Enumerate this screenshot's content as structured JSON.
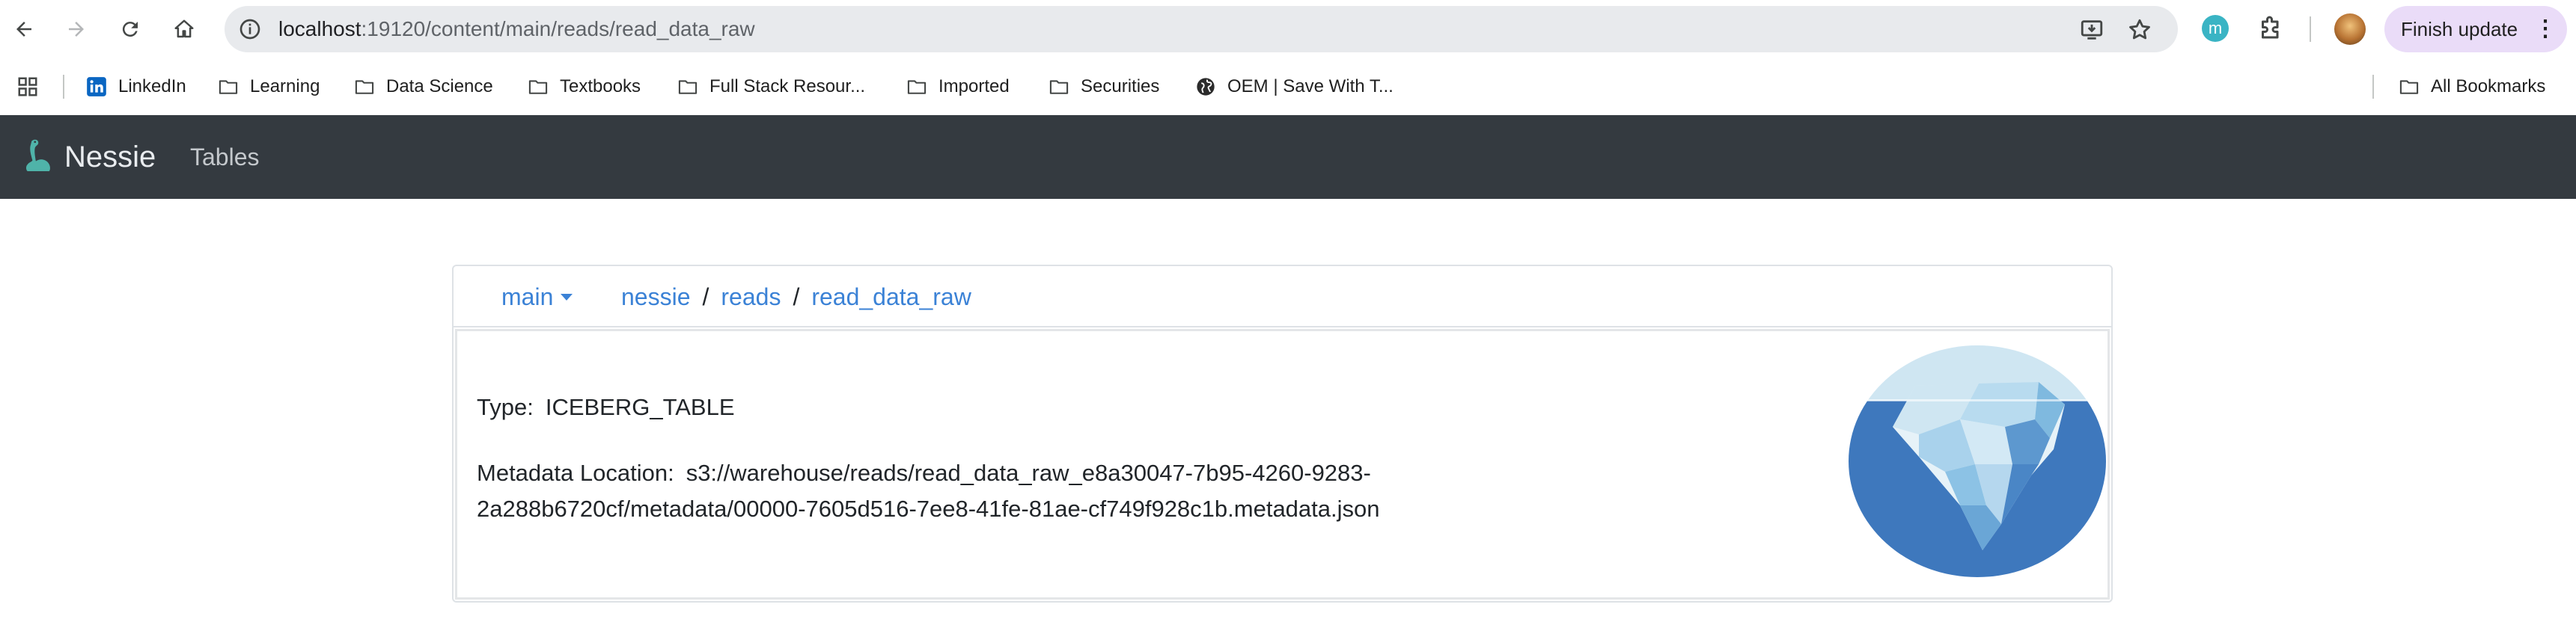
{
  "browser": {
    "url_host": "localhost",
    "url_path": ":19120/content/main/reads/read_data_raw",
    "extension_label": "m",
    "finish_update_label": "Finish update",
    "menu_dots": "⋮"
  },
  "bookmarks": {
    "items": [
      {
        "label": "LinkedIn",
        "icon": "linkedin-icon"
      },
      {
        "label": "Learning",
        "icon": "folder-icon"
      },
      {
        "label": "Data Science",
        "icon": "folder-icon"
      },
      {
        "label": "Textbooks",
        "icon": "folder-icon"
      },
      {
        "label": "Full Stack Resour...",
        "icon": "folder-icon"
      },
      {
        "label": "Imported",
        "icon": "folder-icon"
      },
      {
        "label": "Securities",
        "icon": "folder-icon"
      },
      {
        "label": "OEM | Save With T...",
        "icon": "globe-icon"
      }
    ],
    "all_bookmarks": "All Bookmarks"
  },
  "app": {
    "brand": "Nessie",
    "nav_tables": "Tables",
    "accent_color": "#3b82d6",
    "navbar_color": "#343a40"
  },
  "content": {
    "branch": "main",
    "breadcrumb": [
      "nessie",
      "reads",
      "read_data_raw"
    ],
    "breadcrumb_sep": "/",
    "type_label": "Type:",
    "type_value": "ICEBERG_TABLE",
    "metadata_label": "Metadata Location:",
    "metadata_value_line1": "s3://warehouse/reads/read_data_raw_e8a30047-7b95-4260-9283-",
    "metadata_value_line2": "2a288b6720cf/metadata/00000-7605d516-7ee8-41fe-81ae-cf749f928c1b.metadata.json"
  }
}
